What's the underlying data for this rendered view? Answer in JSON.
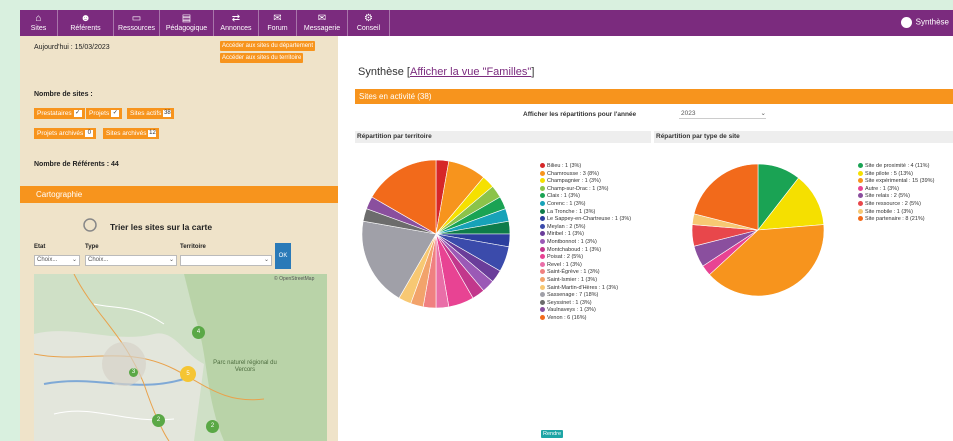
{
  "nav": {
    "items": [
      {
        "label": "Sites",
        "icon": "home-icon"
      },
      {
        "label": "Référents",
        "icon": "users-icon"
      },
      {
        "label": "Ressources",
        "icon": "folder-icon"
      },
      {
        "label": "Pédagogique",
        "icon": "book-icon"
      },
      {
        "label": "Annonces",
        "icon": "arrows-icon"
      },
      {
        "label": "Forum",
        "icon": "chat-icon"
      },
      {
        "label": "Messagerie",
        "icon": "mail-icon"
      },
      {
        "label": "Conseil",
        "icon": "gear-icon"
      }
    ],
    "right_label": "Synthèse",
    "right_icon": "pie-icon"
  },
  "sidebar": {
    "date_text": "Aujourd'hui : 15/03/2023",
    "link_one": "Accéder aux sites du département",
    "link_two": "Accéder aux sites du territoire",
    "sites_heading": "Nombre de sites :",
    "chips": [
      {
        "label": "Prestataires",
        "count": "✓"
      },
      {
        "label": "Projets",
        "count": "✓"
      },
      {
        "label": "Sites actifs",
        "count": "38"
      },
      {
        "label": "Projets archivés",
        "count": "0"
      },
      {
        "label": "Sites archivés",
        "count": "12"
      }
    ],
    "referents_text": "Nombre de Référents : 44",
    "cartography_title": "Cartographie",
    "filter_title": "Trier les sites sur la carte",
    "filters": {
      "etat_label": "Etat",
      "type_label": "Type",
      "territoire_label": "Territoire",
      "etat_value": "Choix...",
      "type_value": "Choix...",
      "territoire_value": ""
    },
    "go_label": "OK",
    "map_labels": {
      "park": "Parc naturel régional du Vercors",
      "attribution": "© OpenStreetMap"
    },
    "map_markers": [
      {
        "label": "4",
        "color": "#5aa846"
      },
      {
        "label": "3",
        "color": "#5aa846"
      },
      {
        "label": "5",
        "color": "#f5c533"
      },
      {
        "label": "2",
        "color": "#5aa846"
      },
      {
        "label": "2",
        "color": "#5aa846"
      }
    ]
  },
  "main": {
    "title_prefix": "Synthèse [",
    "title_link": "Afficher la vue \"Familles\"",
    "title_suffix": "]",
    "active_sites_bar": "Sites en activité (38)",
    "year_label": "Afficher les répartitions pour l'année",
    "year_value": "2023",
    "panel_left_title": "Répartition par territoire",
    "panel_right_title": "Répartition par type de site",
    "render_label": "Rendre"
  },
  "chart_data": [
    {
      "type": "pie",
      "title": "Répartition par territoire",
      "series": [
        {
          "label": "Bilieu : 1 (3%)",
          "value": 1,
          "color": "#d62728"
        },
        {
          "label": "Chamrousse : 3 (8%)",
          "value": 3,
          "color": "#f7941d"
        },
        {
          "label": "Champagnier : 1 (3%)",
          "value": 1,
          "color": "#f5e000"
        },
        {
          "label": "Champ-sur-Drac : 1 (3%)",
          "value": 1,
          "color": "#8bc34a"
        },
        {
          "label": "Claix : 1 (3%)",
          "value": 1,
          "color": "#1aa354"
        },
        {
          "label": "Corenc : 1 (3%)",
          "value": 1,
          "color": "#17a2b8"
        },
        {
          "label": "La Tronche : 1 (3%)",
          "value": 1,
          "color": "#0e7c4a"
        },
        {
          "label": "Le Sappey-en-Chartreuse : 1 (3%)",
          "value": 1,
          "color": "#2c3e9e"
        },
        {
          "label": "Meylan : 2 (5%)",
          "value": 2,
          "color": "#3b4bab"
        },
        {
          "label": "Miribel : 1 (3%)",
          "value": 1,
          "color": "#6a3d9a"
        },
        {
          "label": "Montbonnot : 1 (3%)",
          "value": 1,
          "color": "#9b59b6"
        },
        {
          "label": "Montchaboud : 1 (3%)",
          "value": 1,
          "color": "#c2378c"
        },
        {
          "label": "Poisat : 2 (5%)",
          "value": 2,
          "color": "#e84393"
        },
        {
          "label": "Revel : 1 (3%)",
          "value": 1,
          "color": "#e96ea8"
        },
        {
          "label": "Saint-Égrève : 1 (3%)",
          "value": 1,
          "color": "#f08080"
        },
        {
          "label": "Saint-Ismier : 1 (3%)",
          "value": 1,
          "color": "#f2a36b"
        },
        {
          "label": "Saint-Martin-d'Hères : 1 (3%)",
          "value": 1,
          "color": "#f7c873"
        },
        {
          "label": "Sassenage : 7 (18%)",
          "value": 7,
          "color": "#a0a0a8"
        },
        {
          "label": "Seyssinet : 1 (3%)",
          "value": 1,
          "color": "#6c6c6c"
        },
        {
          "label": "Vaulnaveys : 1 (3%)",
          "value": 1,
          "color": "#8a4f9e"
        },
        {
          "label": "Venon : 6 (16%)",
          "value": 6,
          "color": "#f26a1b"
        }
      ]
    },
    {
      "type": "pie",
      "title": "Répartition par type de site",
      "series": [
        {
          "label": "Site de proximité : 4 (11%)",
          "value": 4,
          "color": "#1aa354"
        },
        {
          "label": "Site pilote : 5 (13%)",
          "value": 5,
          "color": "#f5e000"
        },
        {
          "label": "Site expérimental : 15 (39%)",
          "value": 15,
          "color": "#f7941d"
        },
        {
          "label": "Autre : 1 (3%)",
          "value": 1,
          "color": "#e84393"
        },
        {
          "label": "Site relais : 2 (5%)",
          "value": 2,
          "color": "#8a4f9e"
        },
        {
          "label": "Site ressource : 2 (5%)",
          "value": 2,
          "color": "#e8474b"
        },
        {
          "label": "Site mobile : 1 (3%)",
          "value": 1,
          "color": "#f7c873"
        },
        {
          "label": "Site partenaire : 8 (21%)",
          "value": 8,
          "color": "#f26a1b"
        }
      ]
    }
  ]
}
